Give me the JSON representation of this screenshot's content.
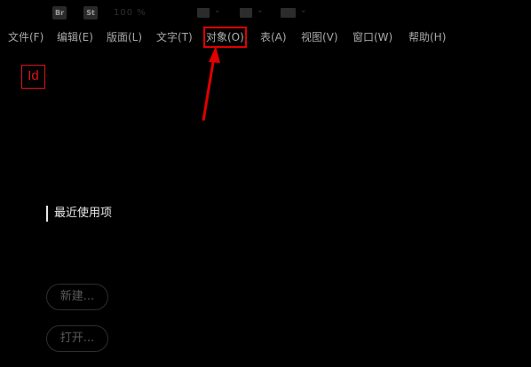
{
  "app_bar": {
    "app_icon": "Br",
    "stock_icon": "St",
    "zoom": "100 %"
  },
  "menu": {
    "items": [
      "文件(F)",
      "编辑(E)",
      "版面(L)",
      "文字(T)",
      "对象(O)",
      "表(A)",
      "视图(V)",
      "窗口(W)",
      "帮助(H)"
    ],
    "highlighted": "对象(O)"
  },
  "logo": {
    "text": "Id"
  },
  "start": {
    "recent_label": "最近使用项",
    "new_button": "新建...",
    "open_button": "打开..."
  },
  "colors": {
    "background": "#000000",
    "highlight": "#e00000",
    "brand": "#e0131c"
  },
  "icons": [
    "bridge-icon",
    "stock-icon",
    "view-icon",
    "screen-mode-icon",
    "workspace-icon",
    "red-arrow-icon"
  ]
}
